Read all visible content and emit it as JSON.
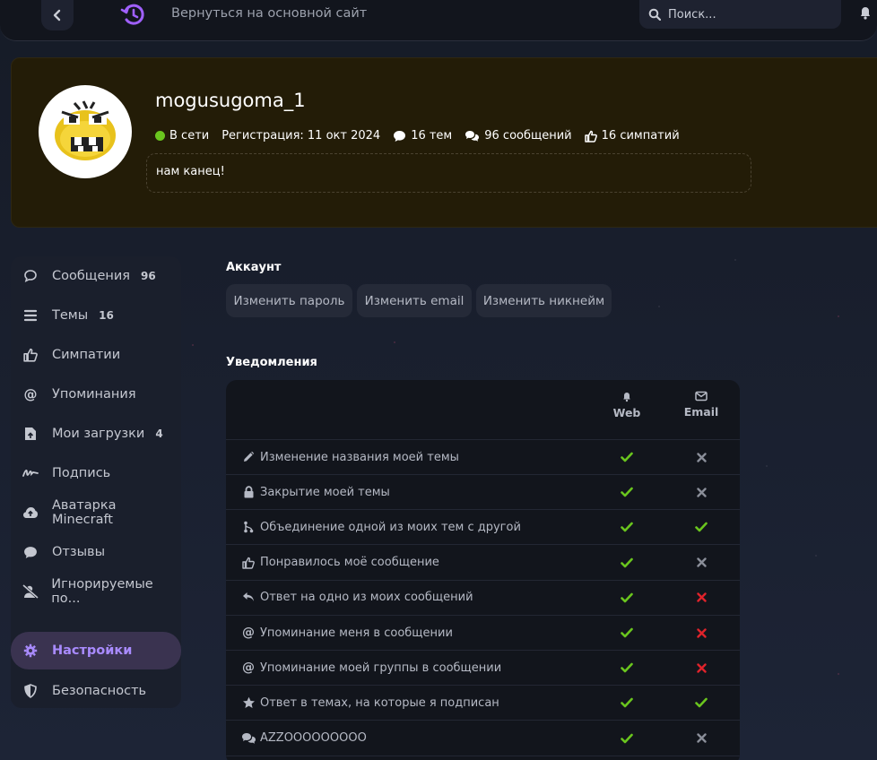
{
  "topbar": {
    "back_link": "Вернуться на основной сайт",
    "search_placeholder": "Поиск..."
  },
  "profile": {
    "username": "mogusugoma_1",
    "online": "В сети",
    "registration": "Регистрация: 11 окт 2024",
    "topics": "16 тем",
    "messages": "96 сообщений",
    "likes": "16 симпатий",
    "status_text": "нам канец!"
  },
  "sidebar": {
    "items": [
      {
        "label": "Сообщения",
        "count": "96",
        "icon": "chat-icon"
      },
      {
        "label": "Темы",
        "count": "16",
        "icon": "list-icon"
      },
      {
        "label": "Симпатии",
        "count": "",
        "icon": "thumbs-up-icon"
      },
      {
        "label": "Упоминания",
        "count": "",
        "icon": "at-icon"
      },
      {
        "label": "Мои загрузки",
        "count": "4",
        "icon": "upload-file-icon"
      },
      {
        "label": "Подпись",
        "count": "",
        "icon": "signature-icon"
      },
      {
        "label": "Аватарка Minecraft",
        "count": "",
        "icon": "cloud-upload-icon"
      },
      {
        "label": "Отзывы",
        "count": "",
        "icon": "comment-icon"
      },
      {
        "label": "Игнорируемые по...",
        "count": "",
        "icon": "user-slash-icon"
      },
      {
        "label": "Настройки",
        "count": "",
        "icon": "gear-icon"
      },
      {
        "label": "Безопасность",
        "count": "",
        "icon": "shield-icon"
      }
    ]
  },
  "account": {
    "title": "Аккаунт",
    "buttons": [
      "Изменить пароль",
      "Изменить email",
      "Изменить никнейм"
    ]
  },
  "notifications": {
    "title": "Уведомления",
    "col_web": "Web",
    "col_email": "Email",
    "rows": [
      {
        "label": "Изменение названия моей темы",
        "icon": "pencil-icon",
        "web": "check",
        "email": "x-gray"
      },
      {
        "label": "Закрытие моей темы",
        "icon": "lock-icon",
        "web": "check",
        "email": "x-gray"
      },
      {
        "label": "Объединение одной из моих тем с другой",
        "icon": "merge-icon",
        "web": "check",
        "email": "check"
      },
      {
        "label": "Понравилось моё сообщение",
        "icon": "thumbs-up-icon",
        "web": "check",
        "email": "x-gray"
      },
      {
        "label": "Ответ на одно из моих сообщений",
        "icon": "reply-icon",
        "web": "check",
        "email": "x-red"
      },
      {
        "label": "Упоминание меня в сообщении",
        "icon": "at-icon",
        "web": "check",
        "email": "x-red"
      },
      {
        "label": "Упоминание моей группы в сообщении",
        "icon": "at-icon",
        "web": "check",
        "email": "x-red"
      },
      {
        "label": "Ответ в темах, на которые я подписан",
        "icon": "star-icon",
        "web": "check",
        "email": "check"
      },
      {
        "label": "AZZOOOOOOOOO",
        "icon": "comments-icon",
        "web": "check",
        "email": "x-gray"
      }
    ]
  },
  "colors": {
    "accent": "#a98bff",
    "check": "#6ac51e",
    "x_red": "#e0232b",
    "x_gray": "#8a8e99",
    "online": "#6ac51e"
  }
}
